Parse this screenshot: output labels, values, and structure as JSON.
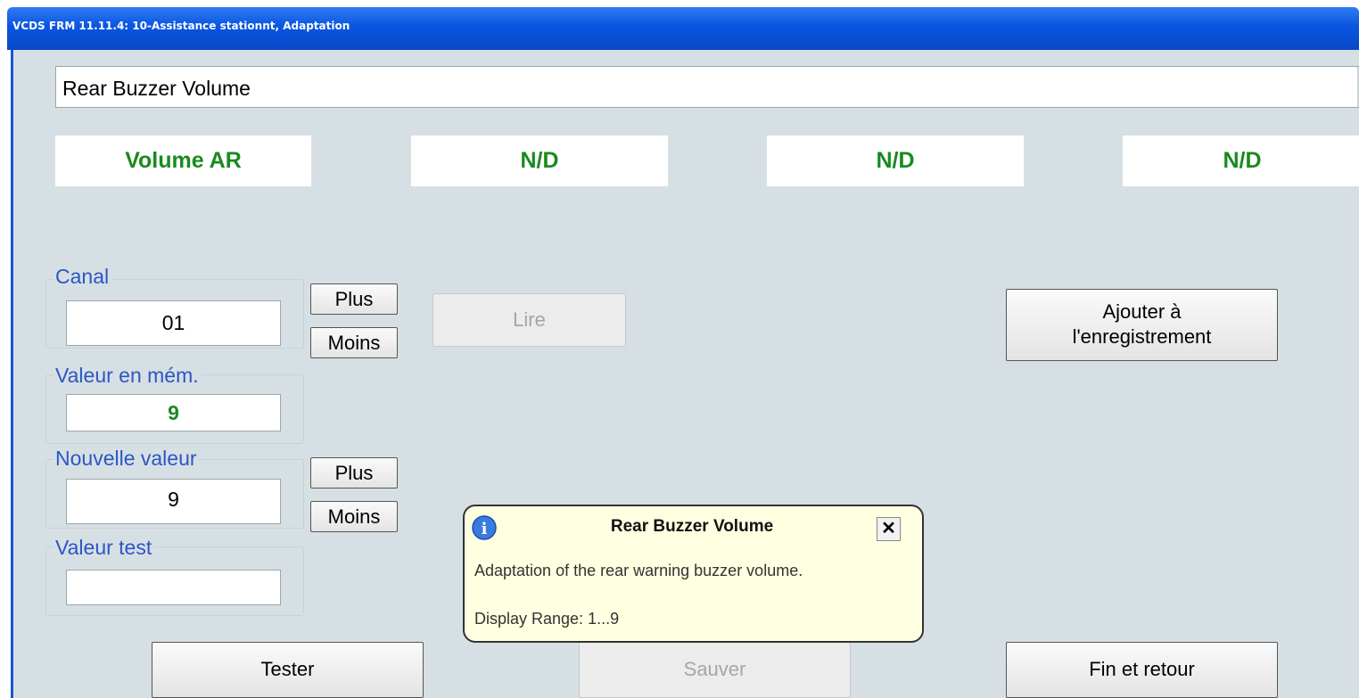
{
  "window": {
    "title": "VCDS FRM 11.11.4: 10-Assistance stationnt,  Adaptation"
  },
  "channel_select": {
    "value": "Rear Buzzer Volume"
  },
  "display_fields": [
    "Volume AR",
    "N/D",
    "N/D",
    "N/D"
  ],
  "canal": {
    "label": "Canal",
    "value": "01",
    "plus_label": "Plus",
    "minus_label": "Moins"
  },
  "stored": {
    "label": "Valeur en mém.",
    "value": "9"
  },
  "new_value": {
    "label": "Nouvelle valeur",
    "value": "9",
    "plus_label": "Plus",
    "minus_label": "Moins"
  },
  "test_value": {
    "label": "Valeur test",
    "value": ""
  },
  "read_button": "Lire",
  "add_log_button": {
    "line1": "Ajouter à",
    "line2": "l'enregistrement"
  },
  "tooltip": {
    "title": "Rear Buzzer Volume",
    "close_label": "✕",
    "description": "Adaptation of the rear warning buzzer volume.",
    "range": "Display Range: 1...9"
  },
  "footer": {
    "test_button": "Tester",
    "save_button": "Sauver",
    "done_button": "Fin et retour"
  },
  "colors": {
    "title_bar": "#0a55e0",
    "background": "#d6e0e4",
    "label_blue": "#2c56c4",
    "value_green": "#1a8a1f",
    "tooltip_bg": "#ffffe1"
  }
}
